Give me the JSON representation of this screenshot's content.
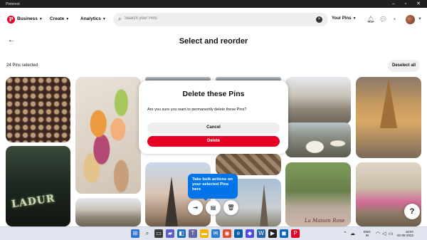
{
  "window": {
    "title": "Pinterest"
  },
  "header": {
    "logo_letter": "P",
    "nav": {
      "business": "Business",
      "create": "Create",
      "analytics": "Analytics"
    },
    "search": {
      "placeholder": "Search your Pins"
    },
    "account_label": "Your Pins"
  },
  "page": {
    "title": "Select and reorder",
    "selected_count": "24 Pins selected",
    "deselect_label": "Deselect all"
  },
  "pins": {
    "ladur_sign": "LADUR",
    "maison_sign": "La Maison Rose"
  },
  "modal": {
    "title": "Delete these Pins",
    "message": "Are you sure you want to permanently delete these Pins?",
    "cancel_label": "Cancel",
    "delete_label": "Delete"
  },
  "bulk": {
    "tooltip": "Take bulk actions on your selected Pins here"
  },
  "help_label": "?",
  "taskbar": {
    "lang_top": "ENG",
    "lang_bottom": "IN",
    "time": "18:07",
    "date": "02-05-2022"
  },
  "colors": {
    "brand": "#e60023",
    "tooltip": "#0074e8"
  }
}
